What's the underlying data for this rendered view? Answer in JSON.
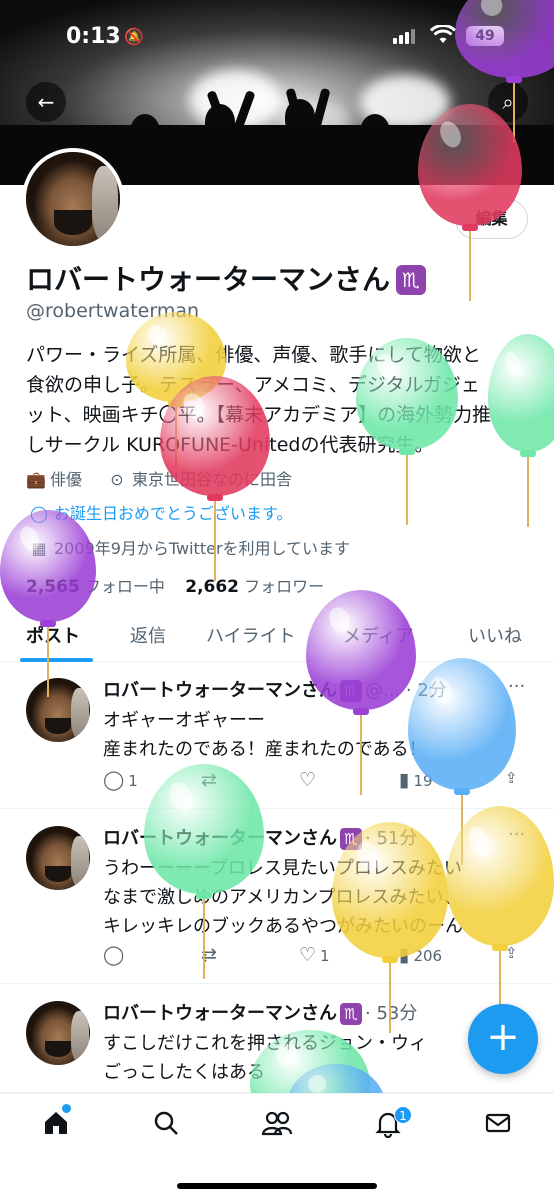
{
  "status_bar": {
    "time": "0:13",
    "battery": "49"
  },
  "profile": {
    "edit_label": "編集",
    "name": "ロバートウォーターマンさん",
    "sign": "♏",
    "handle": "@robertwaterman",
    "bio_lines": [
      "パワー・ライズ所属、俳優、声優、歌手にして物欲と",
      "食欲の申し子。テスラー、アメコミ、デジタルガジェ",
      "ット、映画キチ〇平。【幕末アカデミア】の海外勢力推",
      "しサークル KUROFUNE-Unitedの代表研究生。"
    ],
    "profession": "俳優",
    "location": "東京世田谷なのに田舎",
    "birthday": "お誕生日おめでとうございます。",
    "joined": "2009年9月からTwitterを利用しています",
    "following_count": "2,565",
    "following_label": "フォロー中",
    "followers_count": "2,662",
    "followers_label": "フォロワー"
  },
  "tabs": [
    {
      "label": "ポスト"
    },
    {
      "label": "返信"
    },
    {
      "label": "ハイライト"
    },
    {
      "label": "メディア"
    },
    {
      "label": "いいね"
    }
  ],
  "posts": [
    {
      "author": "ロバートウォーターマンさん",
      "sign": "♏",
      "handle_time": "@... · 2分",
      "lines": [
        "オギャーオギャーー",
        "産まれたのである！産まれたのである！"
      ],
      "replies": "1",
      "reposts": "",
      "likes": "",
      "views": "19"
    },
    {
      "author": "ロバートウォーターマンさん",
      "sign": "♏",
      "handle_time": "· 51分",
      "lines": [
        "うわーーーープロレス見たいプロレスみたい",
        "なまで激しめのアメリカンプロレスみたい、",
        "キレッキレのブックあるやつがみたいのーん"
      ],
      "replies": "",
      "reposts": "",
      "likes": "1",
      "views": "206"
    },
    {
      "author": "ロバートウォーターマンさん",
      "sign": "♏",
      "handle_time": "· 53分",
      "lines": [
        "すこしだけこれを押されるジョン・ウィ",
        "ごっこしたくはある"
      ],
      "replies": "",
      "reposts": "",
      "likes": "",
      "views": ""
    }
  ],
  "nav": {
    "notifications_badge": "1"
  },
  "colors": {
    "accent": "#1d9bf0",
    "text": "#0f1419",
    "muted": "#536471"
  }
}
